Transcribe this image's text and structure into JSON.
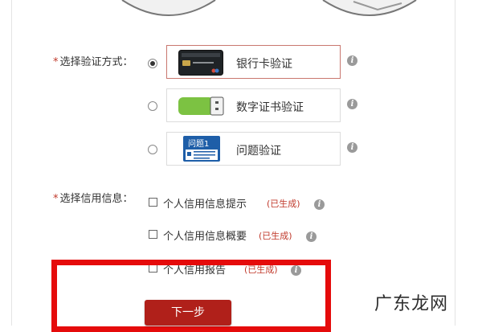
{
  "verification": {
    "label": "选择验证方式：",
    "options": [
      {
        "label": "银行卡验证",
        "selected": true,
        "icon": "bank-card-icon"
      },
      {
        "label": "数字证书验证",
        "selected": false,
        "icon": "digital-certificate-icon"
      },
      {
        "label": "问题验证",
        "selected": false,
        "icon": "question-card-icon",
        "icon_text": "问题1"
      }
    ]
  },
  "credit_info": {
    "label": "选择信用信息：",
    "items": [
      {
        "label": "个人信用信息提示",
        "status": "(已生成)"
      },
      {
        "label": "个人信用信息概要",
        "status": "(已生成)"
      },
      {
        "label": "个人信用报告",
        "status": "(已生成)"
      }
    ]
  },
  "next_button": {
    "label": "下一步"
  },
  "watermark": "广东龙网",
  "colors": {
    "accent": "#b0201a",
    "highlight": "#e50b0b",
    "required_star": "#c0392b"
  }
}
